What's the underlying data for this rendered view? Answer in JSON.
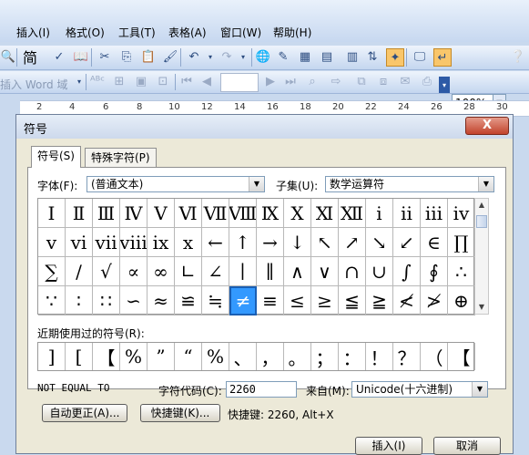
{
  "menu": {
    "items": [
      "插入(I)",
      "格式(O)",
      "工具(T)",
      "表格(A)",
      "窗口(W)",
      "帮助(H)"
    ]
  },
  "toolbar": {
    "zoom": "100%",
    "word_field_label": "插入 Word 域",
    "font_size_glyph": "简"
  },
  "ruler": {
    "numbers": [
      "2",
      "4",
      "6",
      "8",
      "10",
      "12",
      "14",
      "16",
      "18",
      "20",
      "22",
      "24",
      "26",
      "28",
      "30"
    ]
  },
  "dialog": {
    "title": "符号",
    "close": "X",
    "tabs": [
      "符号(S)",
      "特殊字符(P)"
    ],
    "font_label": "字体(F):",
    "font_value": "(普通文本)",
    "subset_label": "子集(U):",
    "subset_value": "数学运算符",
    "symbols": [
      [
        "Ⅰ",
        "Ⅱ",
        "Ⅲ",
        "Ⅳ",
        "Ⅴ",
        "Ⅵ",
        "Ⅶ",
        "Ⅷ",
        "Ⅸ",
        "Ⅹ",
        "Ⅺ",
        "Ⅻ",
        "ⅰ",
        "ⅱ",
        "ⅲ",
        "ⅳ"
      ],
      [
        "ⅴ",
        "ⅵ",
        "ⅶ",
        "ⅷ",
        "ⅸ",
        "ⅹ",
        "←",
        "↑",
        "→",
        "↓",
        "↖",
        "↗",
        "↘",
        "↙",
        "∈",
        "∏"
      ],
      [
        "∑",
        "∕",
        "√",
        "∝",
        "∞",
        "∟",
        "∠",
        "∣",
        "∥",
        "∧",
        "∨",
        "∩",
        "∪",
        "∫",
        "∮",
        "∴"
      ],
      [
        "∵",
        "∶",
        "∷",
        "∽",
        "≈",
        "≌",
        "≒",
        "≠",
        "≡",
        "≤",
        "≥",
        "≦",
        "≧",
        "≮",
        "≯",
        "⊕"
      ]
    ],
    "selected_symbol": "≠",
    "recent_label": "近期使用过的符号(R):",
    "recent": [
      "]",
      "[",
      "【",
      "%",
      "”",
      "“",
      "%",
      "、",
      "，",
      "。",
      "；",
      "：",
      "！",
      "？",
      "（",
      "【"
    ],
    "char_name": "NOT EQUAL TO",
    "char_code_label": "字符代码(C):",
    "char_code": "2260",
    "from_label": "来自(M):",
    "from_value": "Unicode(十六进制)",
    "autocorrect_button": "自动更正(A)...",
    "shortcut_button": "快捷键(K)...",
    "shortcut_text": "快捷键: 2260, Alt+X",
    "insert_button": "插入(I)",
    "cancel_button": "取消"
  },
  "colors": {
    "selected_cell": "#3399ff",
    "close_button": "#c2432c"
  }
}
